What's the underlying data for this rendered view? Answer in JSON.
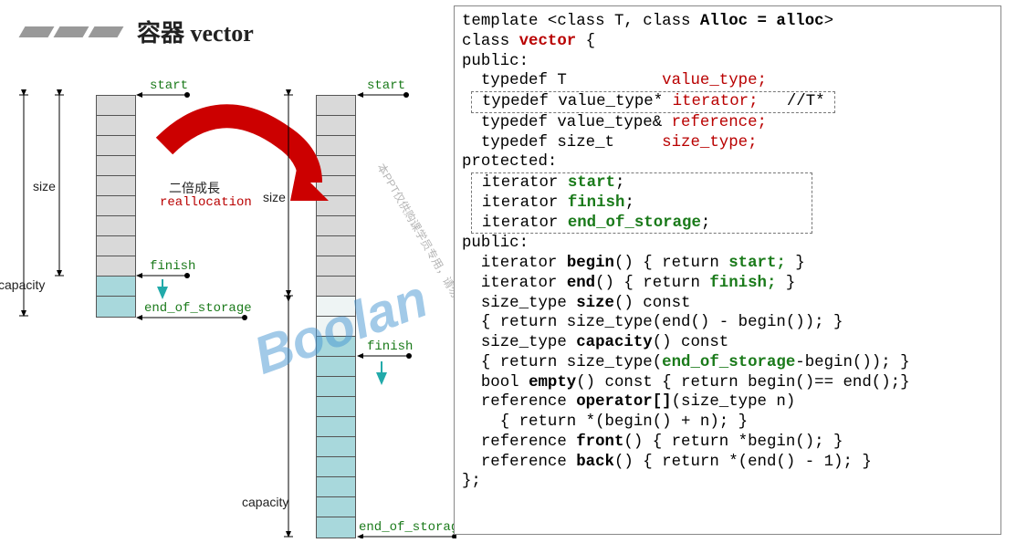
{
  "title": "容器 vector",
  "diagram": {
    "col1": {
      "start": "start",
      "finish": "finish",
      "end_of_storage": "end_of_storage",
      "size": "size",
      "capacity": "capacity"
    },
    "col2": {
      "start": "start",
      "finish": "finish",
      "end_of_storage": "end_of_storage",
      "size": "size",
      "capacity": "capacity"
    },
    "grow_cn": "二倍成長",
    "grow_en": "reallocation"
  },
  "code": {
    "l01a": "template <class T, class ",
    "l01b": "Alloc = alloc",
    "l01c": ">",
    "l02a": "class ",
    "l02b": "vector",
    "l02c": " {",
    "l03": "public:",
    "l04a": "  typedef T          ",
    "l04b": "value_type;",
    "l05a": " typedef value_type* ",
    "l05b": "iterator;",
    "l05c": "   //T* ",
    "l06a": "  typedef value_type& ",
    "l06b": "reference;",
    "l07a": "  typedef size_t     ",
    "l07b": "size_type;",
    "l08": "protected:",
    "l09a": " iterator ",
    "l09b": "start",
    "l09c": ";",
    "l10a": " iterator ",
    "l10b": "finish",
    "l10c": ";",
    "l11a": " iterator ",
    "l11b": "end_of_storage",
    "l11c": "; ",
    "l12": "public:",
    "l13a": "  iterator ",
    "l13b": "begin",
    "l13c": "() { return ",
    "l13d": "start;",
    "l13e": " }",
    "l14a": "  iterator ",
    "l14b": "end",
    "l14c": "() { return ",
    "l14d": "finish;",
    "l14e": " }",
    "l15a": "  size_type ",
    "l15b": "size",
    "l15c": "() const",
    "l16": "  { return size_type(end() - begin()); }",
    "l17a": "  size_type ",
    "l17b": "capacity",
    "l17c": "() const",
    "l18a": "  { return size_type(",
    "l18b": "end_of_storage",
    "l18c": "-begin()); }",
    "l19a": "  bool ",
    "l19b": "empty",
    "l19c": "() const { return begin()== end();}",
    "l20a": "  reference ",
    "l20b": "operator[]",
    "l20c": "(size_type n)",
    "l21": "    { return *(begin() + n); }",
    "l22a": "  reference ",
    "l22b": "front",
    "l22c": "() { return *begin(); }",
    "l23a": "  reference ",
    "l23b": "back",
    "l23c": "() { return *(end() - 1); }",
    "l24": "};"
  },
  "watermark": "Boolan",
  "watermark2": "本PPT仅供购课学员专用，请勿泄露传播。"
}
